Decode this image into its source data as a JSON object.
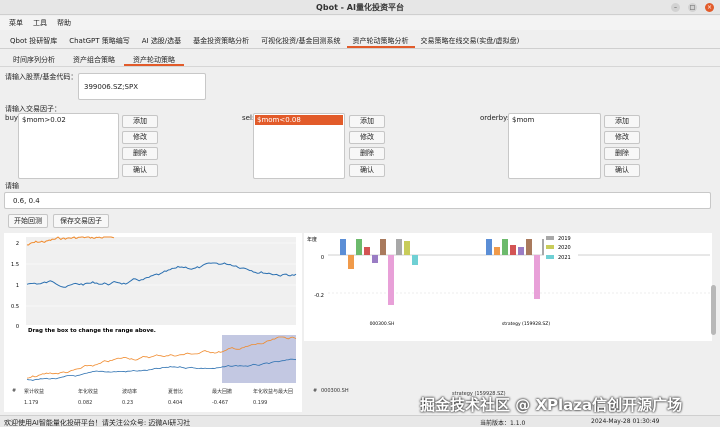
{
  "window": {
    "title": "Qbot - AI量化投资平台"
  },
  "menu": [
    "菜单",
    "工具",
    "帮助"
  ],
  "main_tabs": [
    {
      "label": "Qbot 投研智库"
    },
    {
      "label": "ChatGPT 策略编写"
    },
    {
      "label": "AI 选股/选基"
    },
    {
      "label": "基金投资策略分析"
    },
    {
      "label": "可视化投资/基金回测系统"
    },
    {
      "label": "资产轮动策略分析",
      "active": true
    },
    {
      "label": "交易策略在线交易(实盘/虚拟盘)"
    }
  ],
  "sub_tabs": [
    {
      "label": "时间序列分析"
    },
    {
      "label": "资产组合策略"
    },
    {
      "label": "资产轮动策略",
      "active": true
    }
  ],
  "form": {
    "stock_label": "请输入股票/基金代码：",
    "stock_value": "399006.SZ;SPX",
    "factor_label": "请输入交易因子：",
    "weight_label": "请输",
    "weight_value": "0.6, 0.4"
  },
  "factors": [
    {
      "label": "buy:",
      "items": [
        "$mom>0.02"
      ],
      "selected": -1
    },
    {
      "label": "sel:",
      "items": [
        "$mom<0.08"
      ],
      "selected": 0
    },
    {
      "label": "orderby:",
      "items": [
        "$mom"
      ],
      "selected": -1
    }
  ],
  "factor_buttons": [
    "添加",
    "修改",
    "删除",
    "确认"
  ],
  "actions": {
    "run": "开始回测",
    "save": "保存交易因子"
  },
  "chart_left": {
    "yticks": [
      "2",
      "1.5",
      "1",
      "0.5",
      "0"
    ],
    "zoom_hint": "Drag the box to change the range above."
  },
  "chart_right": {
    "ylabel": "年度",
    "yticks": [
      "0",
      "-0.2"
    ],
    "xlabels": [
      "000300.SH",
      "strategy (159928.SZ)"
    ],
    "legend": [
      {
        "name": "2019",
        "color": "#a8a8a8"
      },
      {
        "name": "2020",
        "color": "#c8cc5a"
      },
      {
        "name": "2021",
        "color": "#6fd0d4"
      }
    ],
    "series_colors": [
      "#5b8ed6",
      "#f09a4a",
      "#6cba6c",
      "#d35454",
      "#9a7cc4",
      "#a97a5d",
      "#e8a0d8",
      "#a8a8a8",
      "#c8cc5a",
      "#6fd0d4"
    ]
  },
  "stats": {
    "headers": [
      "#",
      "累计收益",
      "年化收益",
      "波动率",
      "夏普比",
      "最大回撤",
      "年化收益与最大回",
      "#",
      "000300.SH"
    ],
    "values": [
      "",
      "1.179",
      "0.082",
      "0.23",
      "0.404",
      "-0.467",
      "0.199"
    ],
    "bottom_label": "strategy (159928.SZ)"
  },
  "status": {
    "message": "欢迎使用AI智能量化投研平台！请关注公众号: 迈微AI研习社",
    "version": "当前版本：1.1.0",
    "timestamp": "2024-May-28 01:30:49"
  },
  "watermark": "掘金技术社区 @ XPlaza信创开源广场",
  "colors": {
    "accent": "#e25b2a",
    "series1": "#f08a2c",
    "series2": "#2a6fb0"
  }
}
